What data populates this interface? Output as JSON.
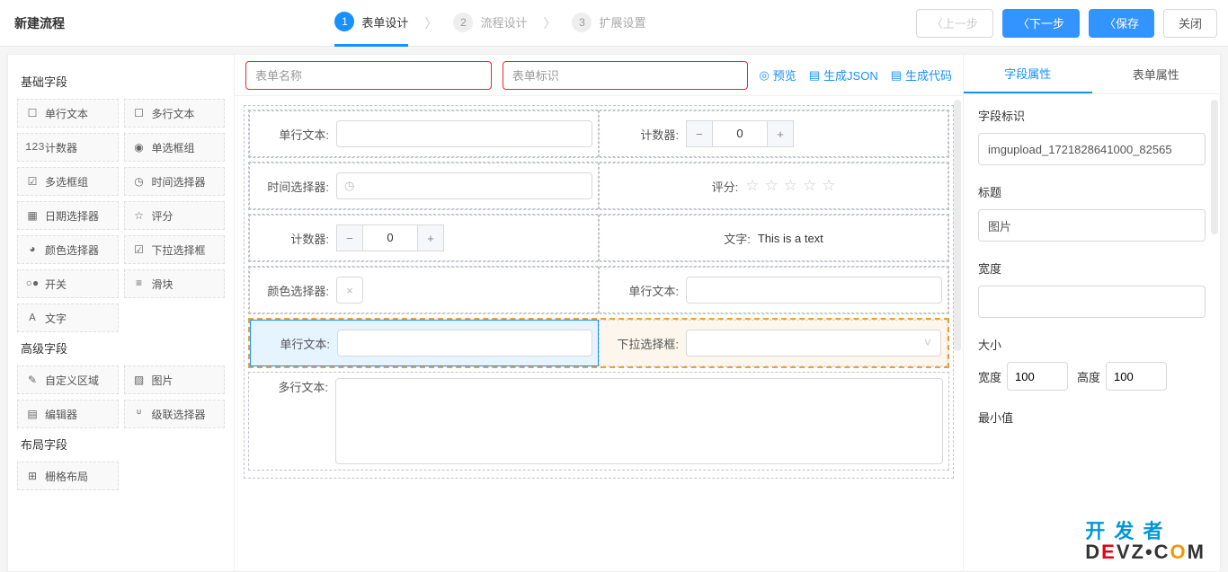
{
  "header": {
    "title": "新建流程",
    "steps": [
      {
        "num": "1",
        "label": "表单设计",
        "active": true
      },
      {
        "num": "2",
        "label": "流程设计",
        "active": false
      },
      {
        "num": "3",
        "label": "扩展设置",
        "active": false
      }
    ],
    "prev": "上一步",
    "next": "下一步",
    "save": "保存",
    "close": "关闭"
  },
  "left": {
    "section_basic": "基础字段",
    "basic": [
      {
        "icon": "☐",
        "label": "单行文本"
      },
      {
        "icon": "☐",
        "label": "多行文本"
      },
      {
        "icon": "123",
        "label": "计数器"
      },
      {
        "icon": "◉",
        "label": "单选框组"
      },
      {
        "icon": "☑",
        "label": "多选框组"
      },
      {
        "icon": "◷",
        "label": "时间选择器"
      },
      {
        "icon": "▦",
        "label": "日期选择器"
      },
      {
        "icon": "☆",
        "label": "评分"
      },
      {
        "icon": "◕",
        "label": "颜色选择器"
      },
      {
        "icon": "☑",
        "label": "下拉选择框"
      },
      {
        "icon": "○●",
        "label": "开关"
      },
      {
        "icon": "≡",
        "label": "滑块"
      },
      {
        "icon": "A",
        "label": "文字"
      }
    ],
    "section_advanced": "高级字段",
    "advanced": [
      {
        "icon": "✎",
        "label": "自定义区域"
      },
      {
        "icon": "▨",
        "label": "图片"
      },
      {
        "icon": "▤",
        "label": "编辑器"
      },
      {
        "icon": "ᓑ",
        "label": "级联选择器"
      }
    ],
    "section_layout": "布局字段",
    "layout": [
      {
        "icon": "⊞",
        "label": "栅格布局"
      }
    ]
  },
  "center": {
    "name_placeholder": "表单名称",
    "id_placeholder": "表单标识",
    "preview": "预览",
    "gen_json": "生成JSON",
    "gen_code": "生成代码",
    "labels": {
      "text": "单行文本:",
      "counter": "计数器:",
      "timepicker": "时间选择器:",
      "rating": "评分:",
      "literal": "文字:",
      "literal_value": "This is a text",
      "color": "颜色选择器:",
      "select": "下拉选择框:",
      "multiline": "多行文本:"
    },
    "counter_value": "0",
    "close_icon": "×"
  },
  "right": {
    "tab_field": "字段属性",
    "tab_form": "表单属性",
    "field_id_label": "字段标识",
    "field_id_value": "imgupload_1721828641000_82565",
    "title_label": "标题",
    "title_value": "图片",
    "width_label": "宽度",
    "size_label": "大小",
    "size_w_label": "宽度",
    "size_w_value": "100",
    "size_h_label": "高度",
    "size_h_value": "100",
    "min_label": "最小值"
  },
  "watermark": {
    "line1": "开 发 者",
    "line2_pre": "D",
    "line2_e": "E",
    "line2_v": "V",
    "line2_z": "Z",
    "line2_dot": "•",
    "line2_c": "C",
    "line2_o": "O",
    "line2_m": "M"
  }
}
